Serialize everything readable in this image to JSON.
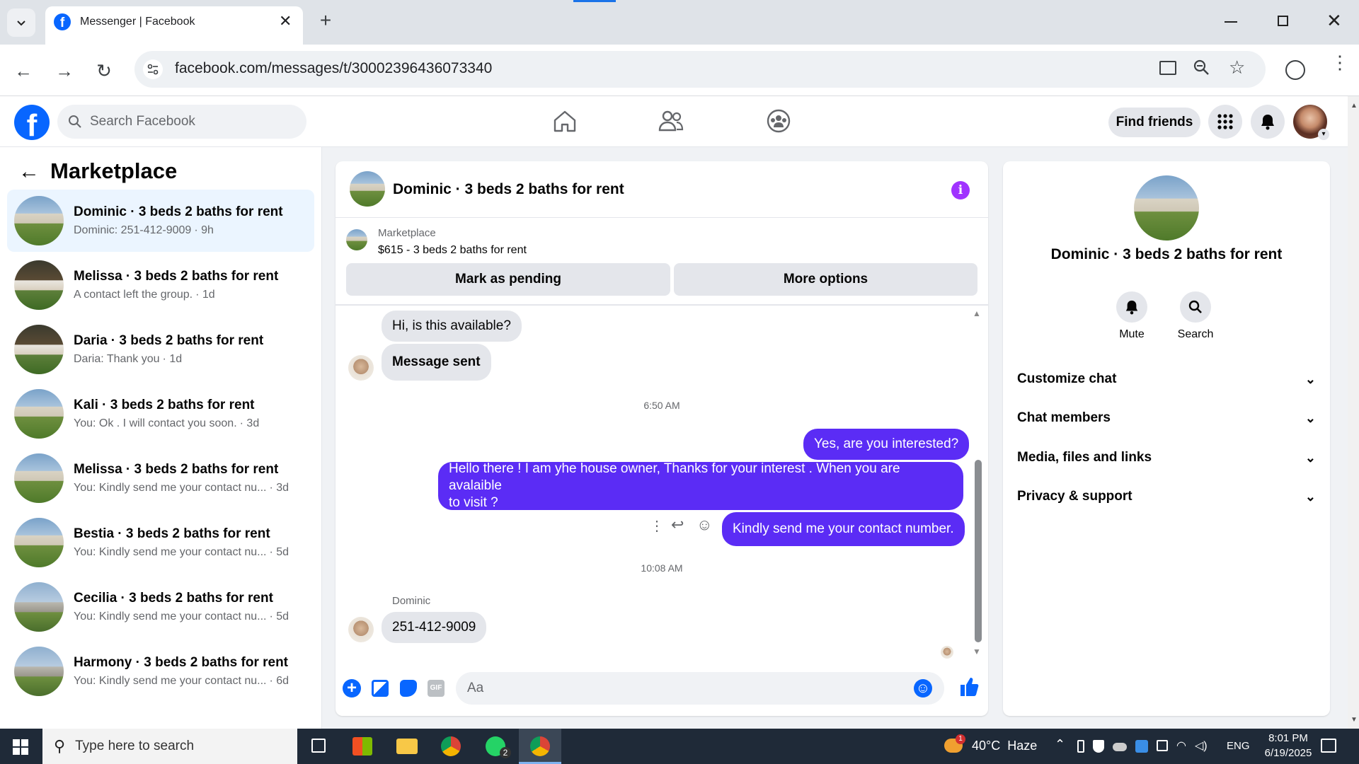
{
  "browser": {
    "tab_title": "Messenger | Facebook",
    "url": "facebook.com/messages/t/30002396436073340"
  },
  "header": {
    "search_placeholder": "Search Facebook",
    "find_friends": "Find friends"
  },
  "sidebar": {
    "title": "Marketplace",
    "conversations": [
      {
        "name": "Dominic · 3 beds 2 baths for rent",
        "preview": "Dominic: 251-412-9009",
        "time": "· 9h",
        "active": true
      },
      {
        "name": "Melissa · 3 beds 2 baths for rent",
        "preview": "A contact left the group.",
        "time": "· 1d"
      },
      {
        "name": "Daria · 3 beds 2 baths for rent",
        "preview": "Daria: Thank you",
        "time": "· 1d"
      },
      {
        "name": "Kali · 3 beds 2 baths for rent",
        "preview": "You: Ok . I will contact you soon.",
        "time": "· 3d"
      },
      {
        "name": "Melissa · 3 beds 2 baths for rent",
        "preview": "You: Kindly send me your contact nu...",
        "time": "· 3d"
      },
      {
        "name": "Bestia · 3 beds 2 baths for rent",
        "preview": "You: Kindly send me your contact nu...",
        "time": "· 5d"
      },
      {
        "name": "Cecilia · 3 beds 2 baths for rent",
        "preview": "You: Kindly send me your contact nu...",
        "time": "· 5d"
      },
      {
        "name": "Harmony · 3 beds 2 baths for rent",
        "preview": "You: Kindly send me your contact nu...",
        "time": "· 6d"
      }
    ]
  },
  "chat": {
    "title": "Dominic · 3 beds 2 baths for rent",
    "listing_source": "Marketplace",
    "listing_text": "$615 - 3 beds 2 baths for rent",
    "mark_pending": "Mark as pending",
    "more_options": "More options",
    "messages": {
      "m1": "Hi, is this available?",
      "m2": "Message sent",
      "time1": "6:50 AM",
      "m3": "Yes, are you interested?",
      "m4a": "Hello there ! I am yhe house owner, Thanks for your interest . When you are avalaible",
      "m4b": "to visit ?",
      "m5": "Kindly send me your contact number.",
      "time2": "10:08 AM",
      "sender": "Dominic",
      "m6": "251-412-9009"
    },
    "composer_placeholder": "Aa"
  },
  "details": {
    "name": "Dominic · 3 beds 2 baths for rent",
    "mute": "Mute",
    "search": "Search",
    "sections": [
      "Customize chat",
      "Chat members",
      "Media, files and links",
      "Privacy & support"
    ]
  },
  "taskbar": {
    "search_placeholder": "Type here to search",
    "weather": "40°C  Haze",
    "lang": "ENG",
    "time": "8:01 PM",
    "date": "6/19/2025",
    "whatsapp_badge": "2",
    "weather_badge": "1"
  },
  "colors": {
    "facebook_blue": "#0866ff",
    "outgoing_bubble": "#5b2cf5",
    "info_purple": "#a033ff"
  }
}
